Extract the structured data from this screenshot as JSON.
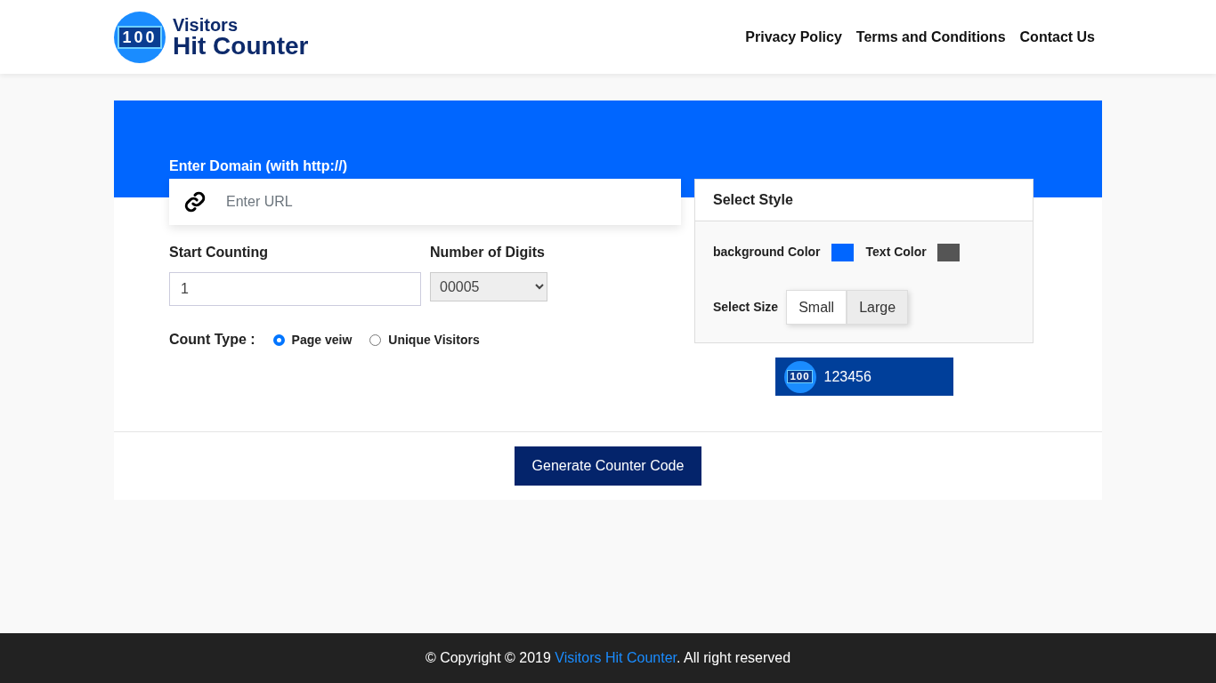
{
  "header": {
    "logo": {
      "digits": "100",
      "line1": "Visitors",
      "line2": "Hit Counter"
    },
    "nav": [
      "Privacy Policy",
      "Terms and Conditions",
      "Contact Us"
    ]
  },
  "form": {
    "domain_label": "Enter Domain (with http://)",
    "url": {
      "placeholder": "Enter URL"
    },
    "start_counting": {
      "label": "Start Counting",
      "value": "1"
    },
    "digits": {
      "label": "Number of Digits",
      "value": "00005"
    },
    "count_type": {
      "label": "Count Type :",
      "options": [
        {
          "label": "Page veiw",
          "selected": true
        },
        {
          "label": "Unique Visitors",
          "selected": false
        }
      ]
    }
  },
  "style_panel": {
    "title": "Select Style",
    "colors": [
      {
        "label": "background Color",
        "color": "#0066ff"
      },
      {
        "label": "Text Color",
        "color": "#555555"
      }
    ],
    "size_label": "Select Size",
    "sizes": [
      {
        "label": "Small",
        "selected": false
      },
      {
        "label": "Large",
        "selected": true
      }
    ]
  },
  "preview": {
    "digits": "100",
    "count": "123456"
  },
  "generate_button": "Generate Counter Code",
  "footer": {
    "prefix": "© Copyright © 2019 ",
    "link": "Visitors Hit Counter",
    "suffix": ". All right reserved"
  }
}
